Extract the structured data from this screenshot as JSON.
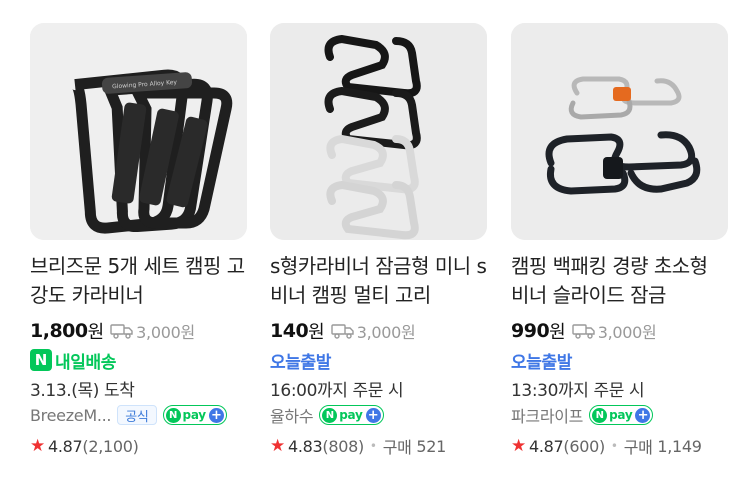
{
  "products": [
    {
      "title": "브리즈문 5개 세트 캠핑 고강도 카라비너",
      "price": "1,800",
      "price_unit": "원",
      "shipping": "3,000원",
      "delivery_badge": "N",
      "delivery_label": "내일배송",
      "delivery_info": "3.13.(목) 도착",
      "seller": "BreezeM...",
      "official_label": "공식",
      "npay_n": "N",
      "npay_label": "pay",
      "npay_plus": "+",
      "rating": "4.87",
      "review_count": "(2,100)",
      "purchase_label": "",
      "purchase_count": "",
      "image_text": "Glowing Pro Alloy Key"
    },
    {
      "title": "s형카라비너 잠금형 미니 s비너 캠핑 멀티 고리",
      "price": "140",
      "price_unit": "원",
      "shipping": "3,000원",
      "delivery_label": "오늘출발",
      "delivery_info": "16:00까지 주문 시",
      "seller": "율하수",
      "npay_n": "N",
      "npay_label": "pay",
      "npay_plus": "+",
      "rating": "4.83",
      "review_count": "(808)",
      "purchase_label": "구매",
      "purchase_count": "521"
    },
    {
      "title": "캠핑 백패킹 경량 초소형 비너 슬라이드 잠금",
      "price": "990",
      "price_unit": "원",
      "shipping": "3,000원",
      "delivery_label": "오늘출발",
      "delivery_info": "13:30까지 주문 시",
      "seller": "파크라이프",
      "npay_n": "N",
      "npay_label": "pay",
      "npay_plus": "+",
      "rating": "4.87",
      "review_count": "(600)",
      "purchase_label": "구매",
      "purchase_count": "1,149"
    }
  ],
  "icons": {
    "truck": "truck-icon",
    "star": "star-icon",
    "npay": "npay-icon"
  },
  "colors": {
    "naver_green": "#03c75a",
    "today_blue": "#3f77e6",
    "star_red": "#ef3232"
  }
}
